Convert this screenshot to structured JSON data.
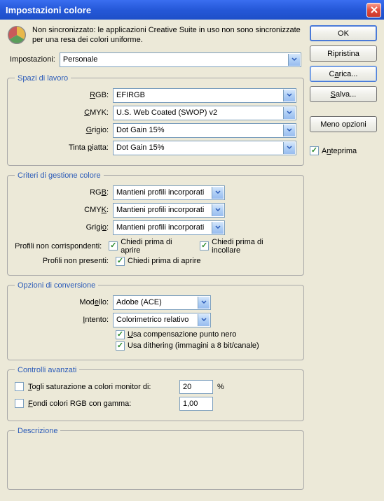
{
  "title": "Impostazioni colore",
  "sync_text": "Non sincronizzato: le applicazioni Creative Suite in uso non sono sincronizzate per una resa dei colori uniforme.",
  "settings": {
    "label": "Impostazioni:",
    "value": "Personale"
  },
  "workspaces": {
    "legend": "Spazi di lavoro",
    "rgb_label": "RGB:",
    "rgb_value": "EFIRGB",
    "cmyk_label": "CMYK:",
    "cmyk_value": "U.S. Web Coated (SWOP) v2",
    "gray_label": "Grigio:",
    "gray_value": "Dot Gain 15%",
    "spot_label": "Tinta piatta:",
    "spot_value": "Dot Gain 15%"
  },
  "policies": {
    "legend": "Criteri di gestione colore",
    "rgb_label": "RGB:",
    "rgb_value": "Mantieni profili incorporati",
    "cmyk_label": "CMYK:",
    "cmyk_value": "Mantieni profili incorporati",
    "gray_label": "Grigio:",
    "gray_value": "Mantieni profili incorporati",
    "mismatch_label": "Profili non corrispondenti:",
    "ask_open": "Chiedi prima di aprire",
    "ask_paste": "Chiedi prima di incollare",
    "missing_label": "Profili non presenti:",
    "ask_open2": "Chiedi prima di aprire"
  },
  "conversion": {
    "legend": "Opzioni di conversione",
    "engine_label": "Modello:",
    "engine_value": "Adobe (ACE)",
    "intent_label": "Intento:",
    "intent_value": "Colorimetrico relativo",
    "bpc": "Usa compensazione punto nero",
    "dither": "Usa dithering (immagini a 8 bit/canale)"
  },
  "advanced": {
    "legend": "Controlli avanzati",
    "desat_label": "Togli saturazione a colori monitor di:",
    "desat_value": "20",
    "desat_unit": "%",
    "blend_label": "Fondi colori RGB con gamma:",
    "blend_value": "1,00"
  },
  "description": {
    "legend": "Descrizione"
  },
  "buttons": {
    "ok": "OK",
    "reset": "Ripristina",
    "load": "Carica...",
    "save": "Salva...",
    "fewer": "Meno opzioni",
    "preview": "Anteprima"
  }
}
